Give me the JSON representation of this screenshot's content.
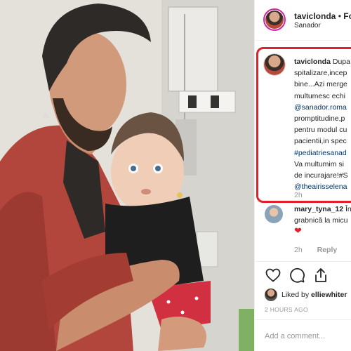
{
  "post": {
    "username": "taviclonda",
    "separator": "•",
    "follow_label": "Fol",
    "location": "Sanador"
  },
  "caption": {
    "username": "taviclonda",
    "lines": [
      "Dupa",
      "spitalizare,incep",
      "bine...Azi merge",
      "multumesc echi",
      "@sanador.roma",
      "promptitudine,p",
      "pentru modul cu",
      "pacientii,in spec",
      "#pediatriesanad",
      "Va multumim si",
      "de incurajare!#S",
      "@theairisselena"
    ],
    "time": "2h"
  },
  "comment": {
    "username": "mary_tyna_12",
    "text_part1": "În",
    "text_line2": "grabnică la micu",
    "emoji": "❤",
    "time": "2h",
    "reply_label": "Reply"
  },
  "likes": {
    "prefix": "Liked by",
    "user": "elliewhiter"
  },
  "time_ago": "2 HOURS AGO",
  "add_comment": {
    "placeholder": "Add a comment..."
  },
  "icons": [
    "heart-icon",
    "comment-icon",
    "share-icon"
  ],
  "colors": {
    "highlight": "#e0212b",
    "link": "#003569",
    "muted": "#999999",
    "story_ring": "#d6249f"
  }
}
